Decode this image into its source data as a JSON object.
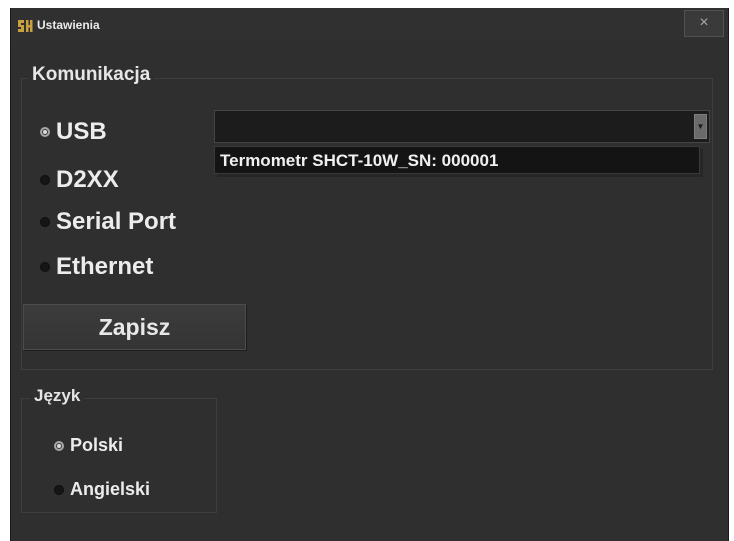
{
  "window": {
    "title": "Ustawienia",
    "close_label": "×"
  },
  "communication": {
    "legend": "Komunikacja",
    "options": [
      {
        "label": "USB",
        "checked": true
      },
      {
        "label": "D2XX",
        "checked": false
      },
      {
        "label": "Serial Port",
        "checked": false
      },
      {
        "label": "Ethernet",
        "checked": false
      }
    ],
    "device_combo": {
      "value": "",
      "dropdown_items": [
        "Termometr SHCT-10W_SN: 000001"
      ]
    },
    "save_label": "Zapisz"
  },
  "language": {
    "legend": "Język",
    "options": [
      {
        "label": "Polski",
        "checked": true
      },
      {
        "label": "Angielski",
        "checked": false
      }
    ]
  },
  "colors": {
    "window_bg": "#2f2f2f",
    "text": "#ececec",
    "combo_bg": "#1c1c1c",
    "icon_gold": "#c8a040"
  },
  "icons": {
    "app": "app-logo-icon",
    "close": "close-icon",
    "combo_arrow": "chevron-down-icon"
  }
}
